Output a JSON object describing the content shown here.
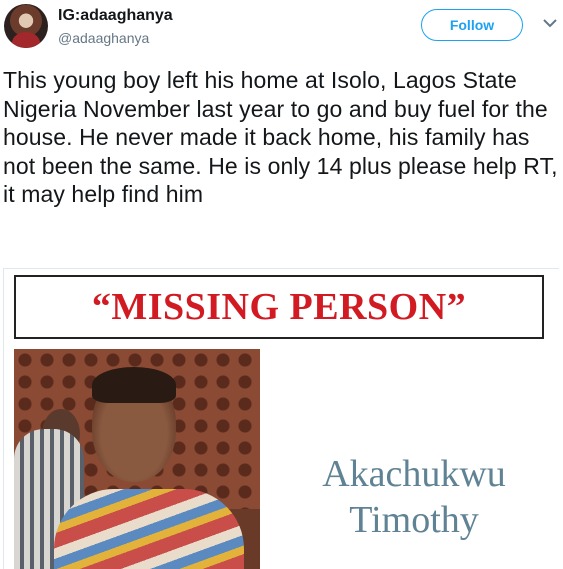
{
  "user": {
    "display_name": "IG:adaaghanya",
    "handle": "@adaaghanya"
  },
  "follow_label": "Follow",
  "tweet_text": "This young boy left his home at Isolo, Lagos State Nigeria November last year to go and buy fuel for the house. He never made it back home, his family has not been the same. He is only 14 plus please help RT, it may help find him",
  "media": {
    "banner": "“MISSING PERSON”",
    "name_line1": "Akachukwu",
    "name_line2": "Timothy"
  },
  "icons": {
    "menu": "chevron-down-icon"
  },
  "colors": {
    "accent": "#1da1f2",
    "banner_text": "#d11a22",
    "name_text": "#5f8294"
  }
}
